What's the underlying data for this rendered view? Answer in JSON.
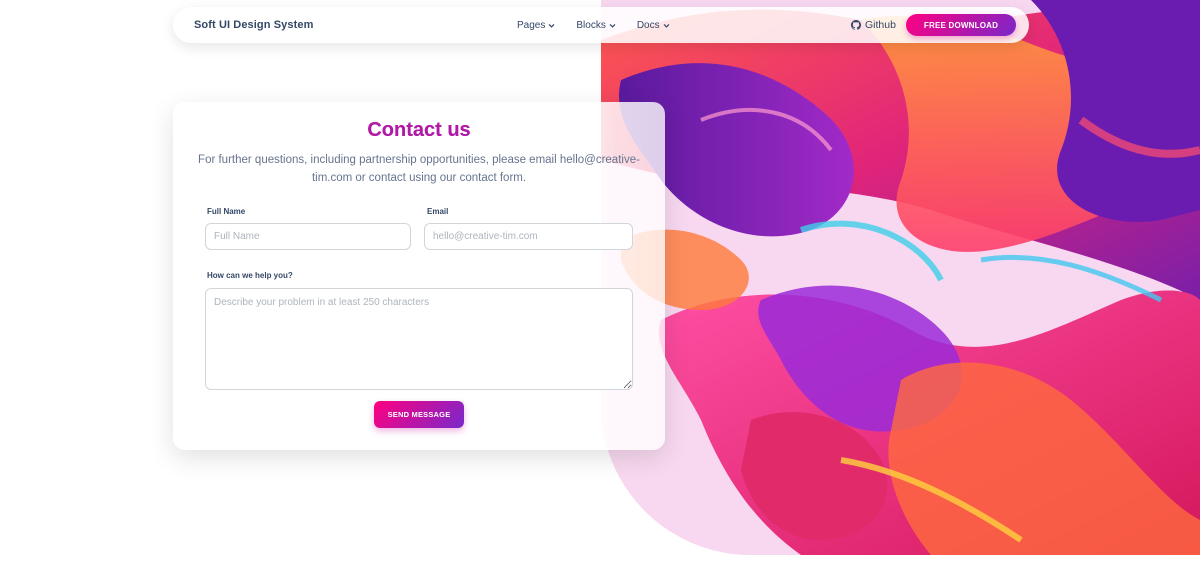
{
  "navbar": {
    "brand": "Soft UI Design System",
    "links": [
      {
        "label": "Pages",
        "icon": "chevron-down-icon"
      },
      {
        "label": "Blocks",
        "icon": "chevron-down-icon"
      },
      {
        "label": "Docs",
        "icon": "chevron-down-icon"
      }
    ],
    "github": {
      "label": "Github",
      "icon": "github-icon"
    },
    "download_button": "FREE DOWNLOAD"
  },
  "contact": {
    "title": "Contact us",
    "subtitle": "For further questions, including partnership opportunities, please email hello@creative-tim.com or contact using our contact form.",
    "full_name": {
      "label": "Full Name",
      "placeholder": "Full Name",
      "value": ""
    },
    "email": {
      "label": "Email",
      "placeholder": "hello@creative-tim.com",
      "value": ""
    },
    "message": {
      "label": "How can we help you?",
      "placeholder": "Describe your problem in at least 250 characters",
      "value": ""
    },
    "send_button": "SEND MESSAGE"
  },
  "colors": {
    "gradient_start": "#7928ca",
    "gradient_end": "#ff0080",
    "text_dark": "#344767",
    "text_muted": "#67748e"
  }
}
